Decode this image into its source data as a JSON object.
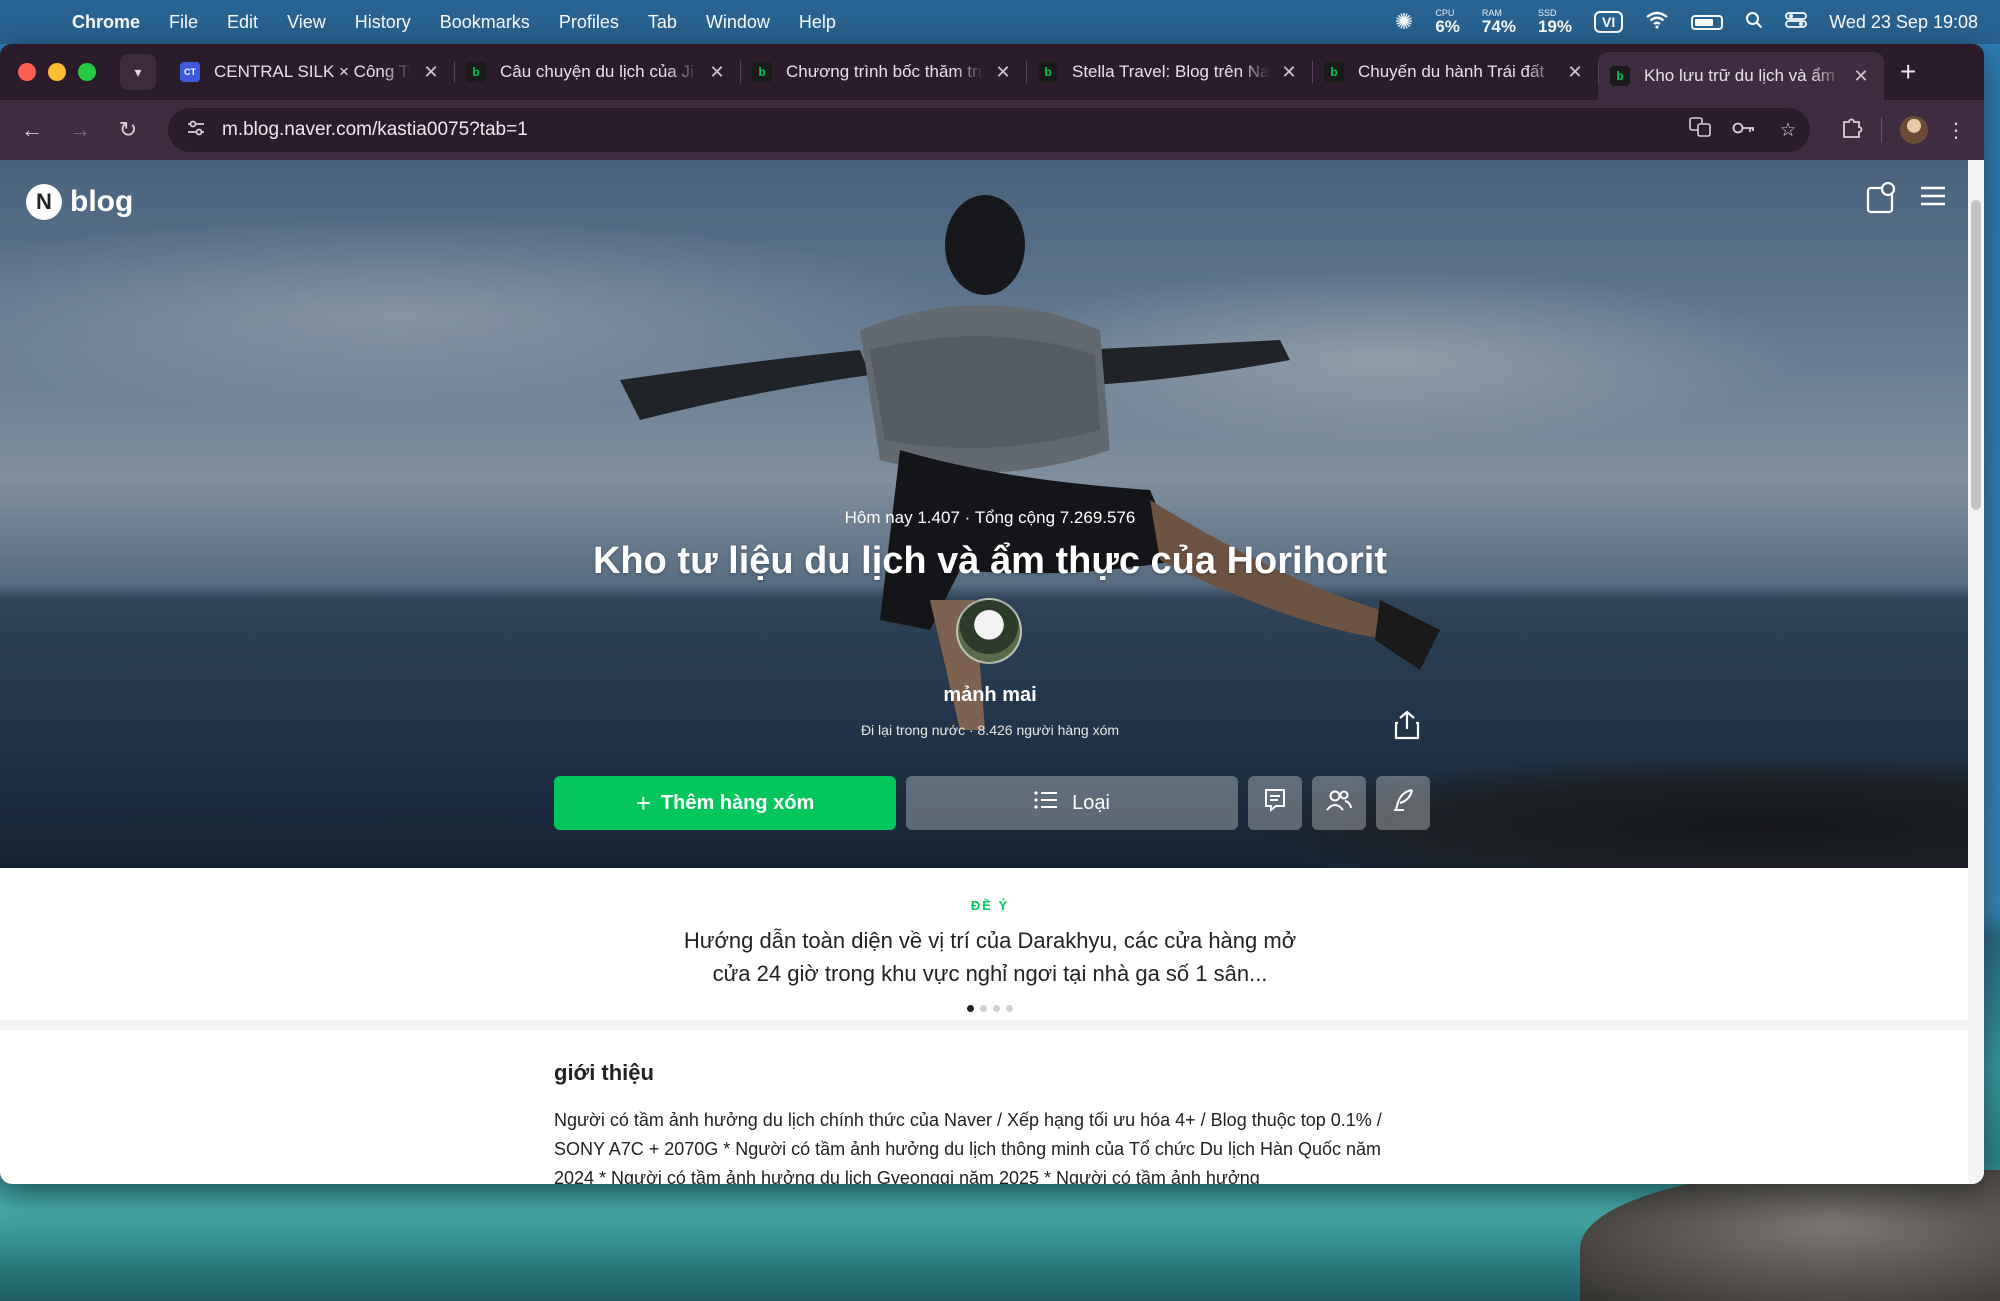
{
  "menubar": {
    "app": "Chrome",
    "items": [
      "File",
      "Edit",
      "View",
      "History",
      "Bookmarks",
      "Profiles",
      "Tab",
      "Window",
      "Help"
    ],
    "cpu_label": "CPU",
    "cpu_value": "6%",
    "ram_label": "RAM",
    "ram_value": "74%",
    "ssd_label": "SSD",
    "ssd_value": "19%",
    "input_lang": "VI",
    "clock": "Wed 23 Sep  19:08"
  },
  "tabs": [
    {
      "favicon": "CT",
      "title": "CENTRAL SILK × Công Ty",
      "active": false
    },
    {
      "favicon": "b",
      "title": "Câu chuyện du lịch của Ji",
      "active": false
    },
    {
      "favicon": "b",
      "title": "Chương trình bốc thăm trúng",
      "active": false
    },
    {
      "favicon": "b",
      "title": "Stella Travel: Blog trên Naver",
      "active": false
    },
    {
      "favicon": "b",
      "title": "Chuyến du hành Trái đất",
      "active": false
    },
    {
      "favicon": "b",
      "title": "Kho lưu trữ du lịch và ẩm thực",
      "active": true
    }
  ],
  "address": {
    "url": "m.blog.naver.com/kastia0075?tab=1"
  },
  "page": {
    "logo_text": "blog",
    "visit_stats": "Hôm nay 1.407 · Tổng cộng 7.269.576",
    "blog_title": "Kho tư liệu du lịch và ẩm thực của Horihorit",
    "nickname": "mảnh mai",
    "meta": "Đi lại trong nước · 8.426 người hàng xóm",
    "add_neighbor": "Thêm hàng xóm",
    "category": "Loại",
    "recommend_label": "ĐỀ Ý",
    "recommend_text": "Hướng dẫn toàn diện về vị trí của Darakhyu, các cửa hàng mở cửa 24 giờ trong khu vực nghỉ ngơi tại nhà ga số 1 sân...",
    "intro_title": "giới thiệu",
    "intro_text": "Người có tầm ảnh hưởng du lịch chính thức của Naver / Xếp hạng tối ưu hóa 4+ / Blog thuộc top 0.1% / SONY A7C + 2070G * Người có tầm ảnh hưởng du lịch thông minh của Tổ chức Du lịch Hàn Quốc năm 2024 * Người có tầm ảnh hưởng du lịch Gyeonggi năm 2025 * Người có tầm ảnh hưởng"
  },
  "colors": {
    "naver_green": "#03c75a",
    "tab_bar": "#2b1c2b",
    "toolbar": "#402c40"
  }
}
